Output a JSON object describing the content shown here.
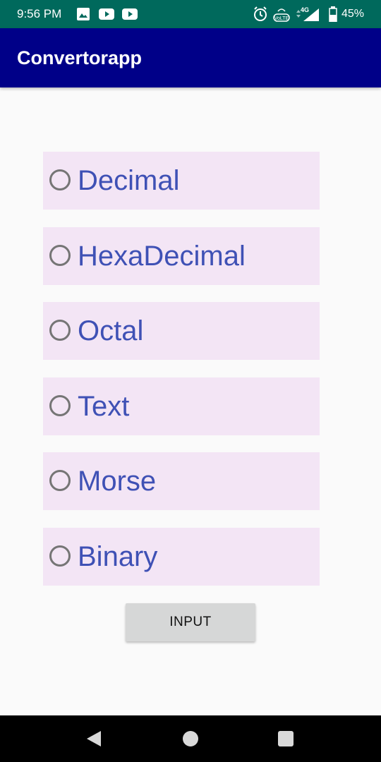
{
  "status_bar": {
    "time": "9:56 PM",
    "notification_icons": [
      "image-icon",
      "youtube-icon",
      "youtube-icon"
    ],
    "system_icons": [
      "alarm-icon",
      "volte-icon",
      "network-4g-icon",
      "signal-icon",
      "battery-icon"
    ],
    "battery_percent": "45%",
    "network_label": "4G",
    "volte_label": "VoLTE"
  },
  "app_bar": {
    "title": "Convertorapp"
  },
  "options": [
    {
      "label": "Decimal",
      "selected": false
    },
    {
      "label": "HexaDecimal",
      "selected": false
    },
    {
      "label": "Octal",
      "selected": false
    },
    {
      "label": "Text",
      "selected": false
    },
    {
      "label": "Morse",
      "selected": false
    },
    {
      "label": "Binary",
      "selected": false
    }
  ],
  "input_button": {
    "label": "INPUT"
  },
  "nav_bar": {
    "buttons": [
      "back-icon",
      "home-icon",
      "recents-icon"
    ]
  },
  "colors": {
    "status_bar": "#00695c",
    "app_bar": "#000088",
    "option_background": "#f3e5f5",
    "option_text": "#3f51b5",
    "button_background": "#d6d7d7"
  }
}
